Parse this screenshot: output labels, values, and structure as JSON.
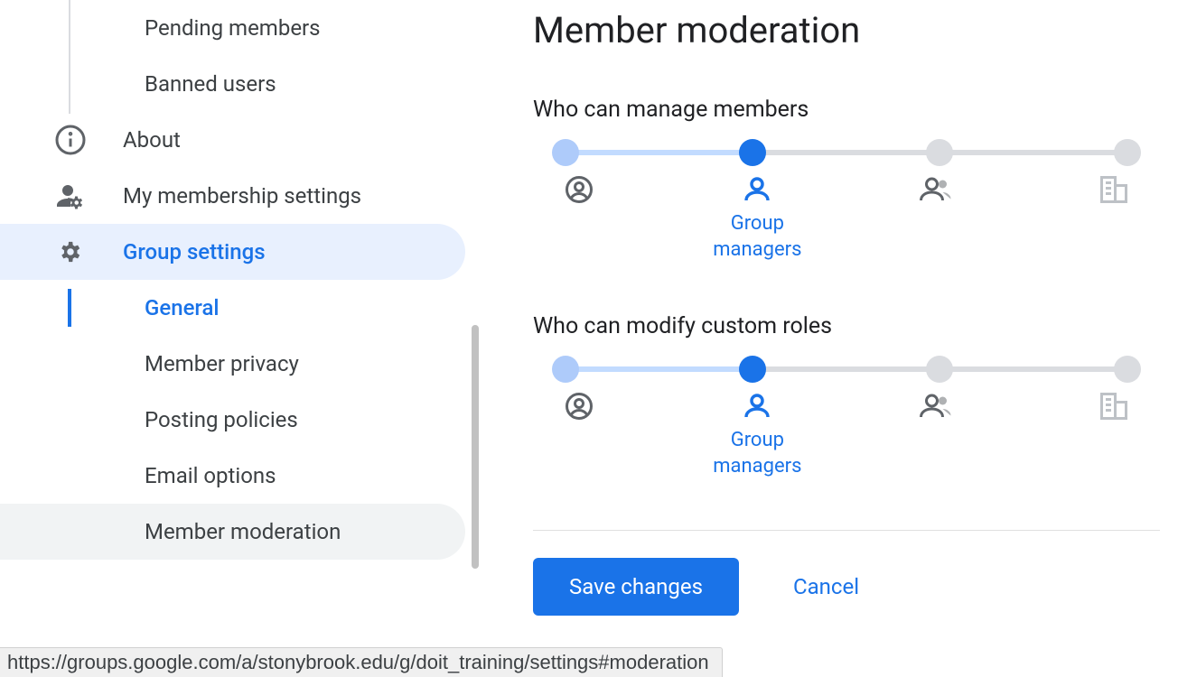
{
  "sidebar": {
    "items": [
      {
        "label": "Pending members"
      },
      {
        "label": "Banned users"
      },
      {
        "label": "About"
      },
      {
        "label": "My membership settings"
      },
      {
        "label": "Group settings"
      },
      {
        "label": "General"
      },
      {
        "label": "Member privacy"
      },
      {
        "label": "Posting policies"
      },
      {
        "label": "Email options"
      },
      {
        "label": "Member moderation"
      }
    ]
  },
  "main": {
    "title": "Member moderation",
    "setting1": {
      "label": "Who can manage members",
      "selected_caption": "Group managers",
      "options": [
        "Group owners",
        "Group managers",
        "Group members",
        "Entire organization"
      ],
      "selected_index": 1
    },
    "setting2": {
      "label": "Who can modify custom roles",
      "selected_caption": "Group managers",
      "options": [
        "Group owners",
        "Group managers",
        "Group members",
        "Entire organization"
      ],
      "selected_index": 1
    },
    "save_label": "Save changes",
    "cancel_label": "Cancel"
  },
  "status_url": "https://groups.google.com/a/stonybrook.edu/g/doit_training/settings#moderation"
}
